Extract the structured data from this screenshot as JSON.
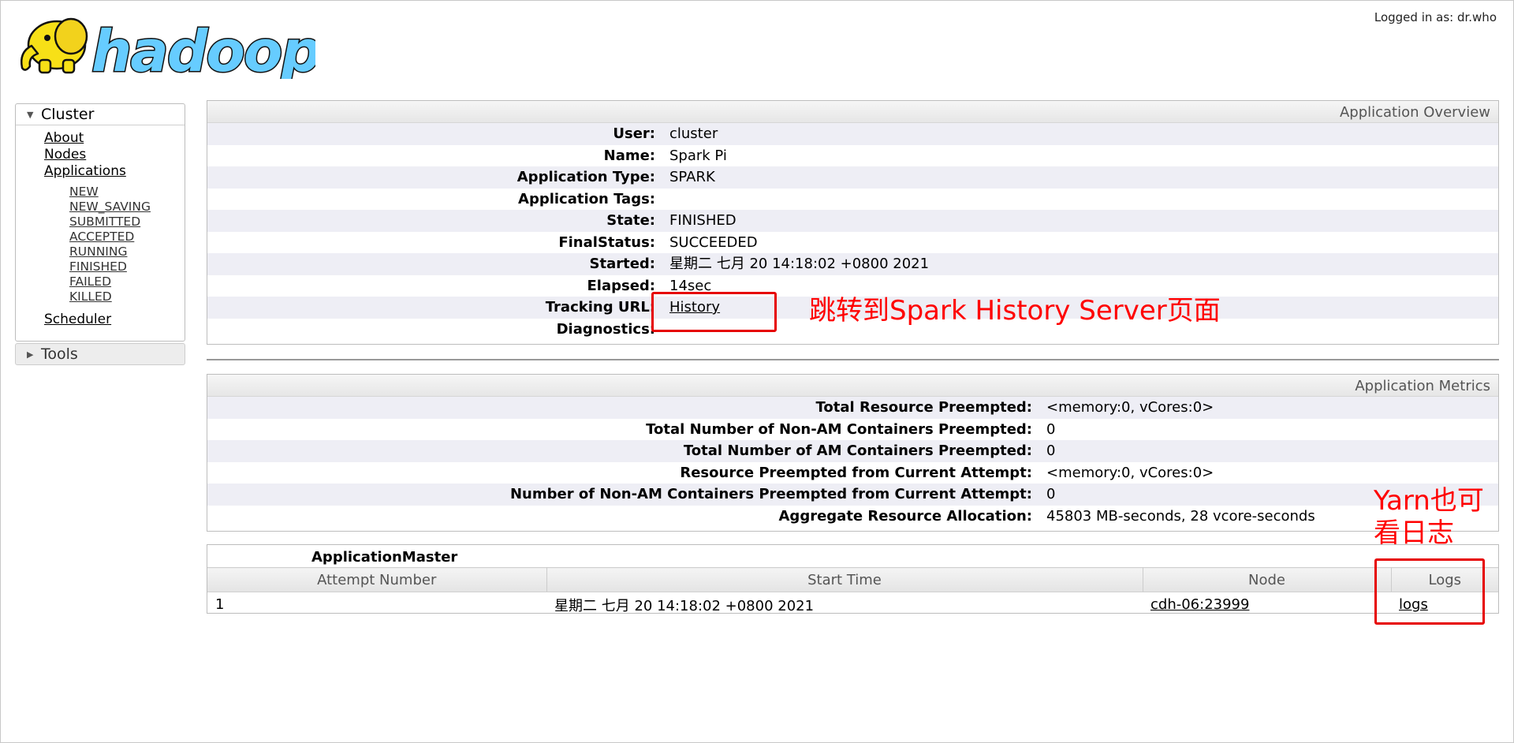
{
  "header": {
    "logo_text": "hadoop",
    "logged_in": "Logged in as: dr.who"
  },
  "sidebar": {
    "cluster": {
      "title": "Cluster",
      "links": [
        "About",
        "Nodes",
        "Applications"
      ],
      "app_states": [
        "NEW",
        "NEW_SAVING",
        "SUBMITTED",
        "ACCEPTED",
        "RUNNING",
        "FINISHED",
        "FAILED",
        "KILLED"
      ],
      "scheduler": "Scheduler"
    },
    "tools": {
      "title": "Tools"
    }
  },
  "overview": {
    "caption": "Application Overview",
    "rows": [
      {
        "key": "User:",
        "value": "cluster"
      },
      {
        "key": "Name:",
        "value": "Spark Pi"
      },
      {
        "key": "Application Type:",
        "value": "SPARK"
      },
      {
        "key": "Application Tags:",
        "value": ""
      },
      {
        "key": "State:",
        "value": "FINISHED"
      },
      {
        "key": "FinalStatus:",
        "value": "SUCCEEDED"
      },
      {
        "key": "Started:",
        "value": "星期二 七月 20 14:18:02 +0800 2021"
      },
      {
        "key": "Elapsed:",
        "value": "14sec"
      },
      {
        "key": "Tracking URL:",
        "value": "History"
      },
      {
        "key": "Diagnostics:",
        "value": ""
      }
    ]
  },
  "metrics": {
    "caption": "Application Metrics",
    "rows": [
      {
        "key": "Total Resource Preempted:",
        "value": "<memory:0, vCores:0>"
      },
      {
        "key": "Total Number of Non-AM Containers Preempted:",
        "value": "0"
      },
      {
        "key": "Total Number of AM Containers Preempted:",
        "value": "0"
      },
      {
        "key": "Resource Preempted from Current Attempt:",
        "value": "<memory:0, vCores:0>"
      },
      {
        "key": "Number of Non-AM Containers Preempted from Current Attempt:",
        "value": "0"
      },
      {
        "key": "Aggregate Resource Allocation:",
        "value": "45803 MB-seconds, 28 vcore-seconds"
      }
    ]
  },
  "app_master": {
    "caption": "ApplicationMaster",
    "columns": [
      "Attempt Number",
      "Start Time",
      "Node",
      "Logs"
    ],
    "rows": [
      {
        "attempt": "1",
        "start_time": "星期二 七月 20 14:18:02 +0800 2021",
        "node": "cdh-06:23999",
        "logs": "logs"
      }
    ]
  },
  "annotations": {
    "history_note": "跳转到Spark History Server页面",
    "logs_note": "Yarn也可看日志",
    "color": "#e60000"
  },
  "colors": {
    "logo_yellow": "#f7e017",
    "logo_blue": "#66ccff",
    "row_stripe": "#eeeef5"
  }
}
